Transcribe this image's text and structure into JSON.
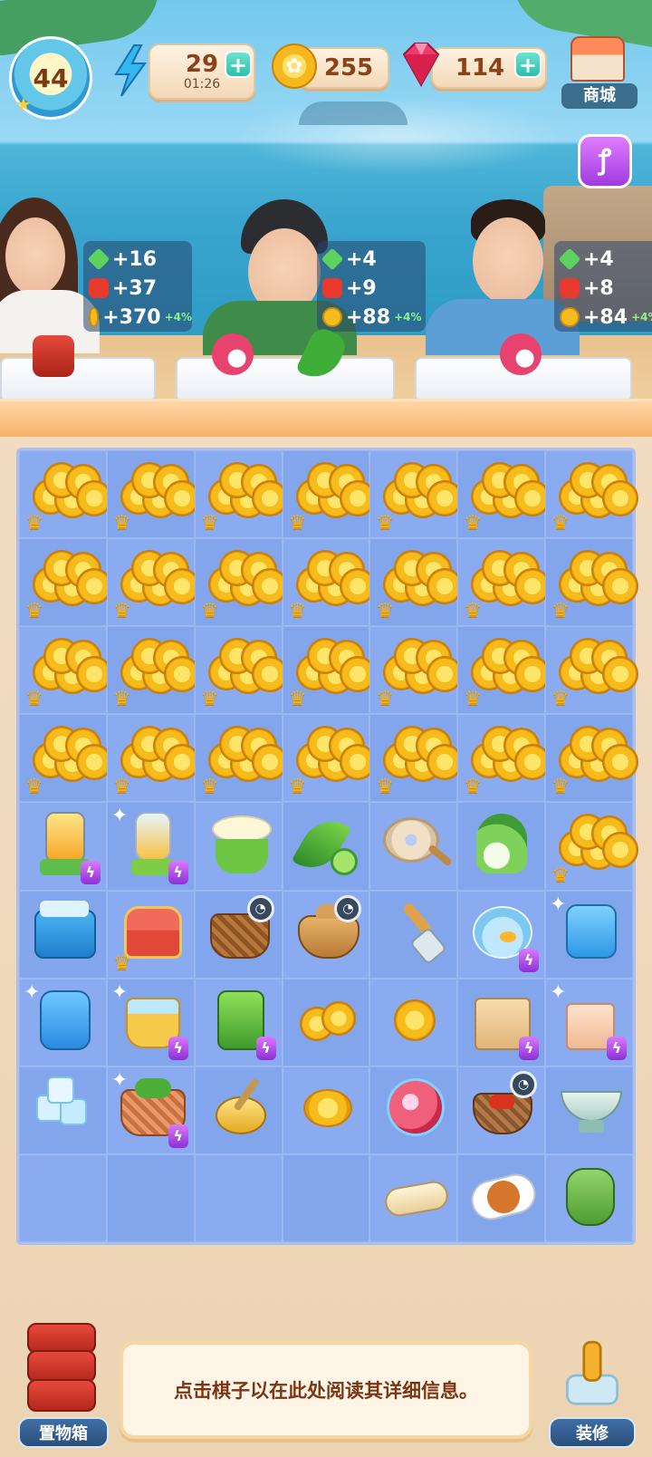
{
  "hud": {
    "level": "44",
    "energy": {
      "value": "29",
      "timer": "01:26",
      "icon": "lightning-bolt-icon"
    },
    "coins": {
      "value": "255",
      "icon": "coin-icon"
    },
    "gems": {
      "value": "114",
      "icon": "ruby-gem-icon"
    },
    "shop_label": "商城",
    "plus_symbol": "+"
  },
  "customers": [
    {
      "xp": "+16",
      "lantern": "+37",
      "coin": "+370",
      "coin_bonus": "+4%"
    },
    {
      "xp": "+4",
      "lantern": "+9",
      "coin": "+88",
      "coin_bonus": "+4%"
    },
    {
      "xp": "+4",
      "lantern": "+8",
      "coin": "+84",
      "coin_bonus": "+4%"
    }
  ],
  "board": {
    "rows": [
      [
        "coins",
        "coins",
        "coins",
        "coins",
        "coins",
        "coins",
        "coins"
      ],
      [
        "coins",
        "coins",
        "coins",
        "coins",
        "coins",
        "coins",
        "coins"
      ],
      [
        "coins",
        "coins",
        "coins",
        "coins",
        "coins",
        "coins",
        "coins"
      ],
      [
        "coins",
        "coins",
        "coins",
        "coins",
        "coins",
        "coins",
        "coins"
      ],
      [
        "juicer",
        "blender",
        "citrus-press",
        "okra",
        "frying-pan",
        "bok-choy",
        "coins"
      ],
      [
        "ice-cooler",
        "treasure-chest",
        "picnic-basket",
        "clay-pot",
        "spatula",
        "fishbowl",
        "mini-fridge"
      ],
      [
        "fridge",
        "water-bucket",
        "coffee-machine",
        "coin-pile",
        "single-coin",
        "grocery-bag",
        "gift-bag"
      ],
      [
        "ice-cubes",
        "vegetable-basket",
        "whisk-bowl",
        "coin-stack",
        "magic-orb",
        "chili-basket",
        "ceramic-bowl"
      ],
      [
        "empty",
        "empty",
        "empty",
        "empty",
        "burrito",
        "roast-dish",
        "tea-kettle"
      ]
    ]
  },
  "bottom": {
    "storage_label": "置物箱",
    "info_text": "点击棋子以在此处阅读其详细信息。",
    "decorate_label": "装修"
  }
}
